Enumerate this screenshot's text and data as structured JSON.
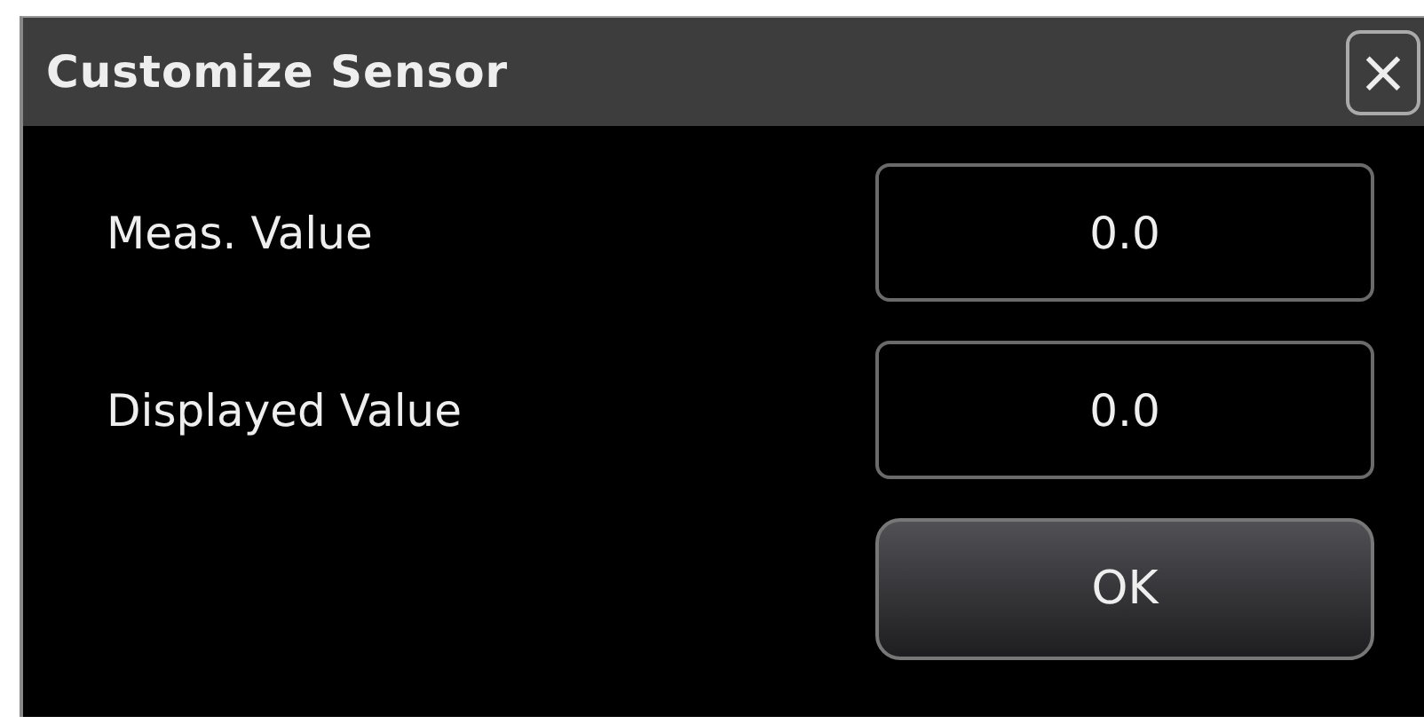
{
  "dialog": {
    "title": "Customize Sensor",
    "close": "×"
  },
  "fields": [
    {
      "label": "Meas. Value",
      "value": "0.0"
    },
    {
      "label": "Displayed Value",
      "value": "0.0"
    }
  ],
  "buttons": [
    "OK"
  ]
}
